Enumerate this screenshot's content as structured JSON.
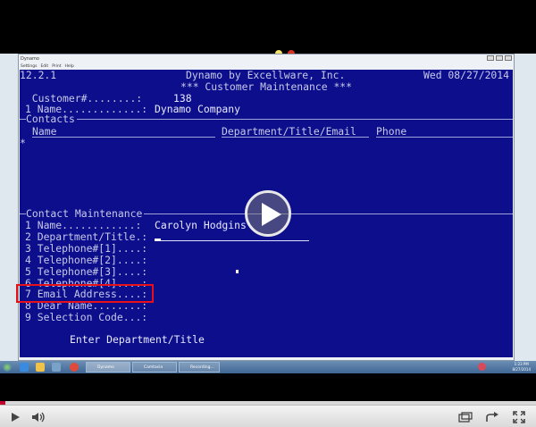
{
  "window": {
    "title": "Dynamo",
    "menu": [
      "Settings",
      "Edit",
      "Print",
      "Help"
    ]
  },
  "terminal": {
    "version": "12.2.1",
    "company": "Dynamo by Excellware, Inc.",
    "date": "Wed 08/27/2014",
    "screen_title": "*** Customer Maintenance ***",
    "customer_label": "  Customer#........:",
    "customer_value": "138",
    "name_label": "1 Name.............:",
    "name_value": "Dynamo Company",
    "contacts_header": "Contacts",
    "col_name": "Name",
    "col_dept": "Department/Title/Email",
    "col_phone": "Phone",
    "row_marker": "*",
    "contact_maint_header": "Contact Maintenance",
    "fields": [
      "1 Name............:",
      "2 Department/Title.:",
      "3 Telephone#[1]....:",
      "4 Telephone#[2]....:",
      "5 Telephone#[3]....:",
      "6 Telephone#[4]....:",
      "7 Email Address....:",
      "8 Dear Name........:",
      "9 Selection Code...:"
    ],
    "contact_name_value": "Carolyn Hodgins",
    "prompt": "Enter Department/Title"
  },
  "taskbar": {
    "tasks": [
      "Dynamo",
      "Camtasia Studio",
      "Recording..."
    ],
    "time": "1:23 PM",
    "date": "8/27/2014"
  },
  "video": {
    "progress_fraction": 0.01
  },
  "colors": {
    "terminal_bg": "#0c0e8c",
    "terminal_fg": "#c7c9e9",
    "annotation": "#e8111a",
    "progress": "#c0002a"
  }
}
